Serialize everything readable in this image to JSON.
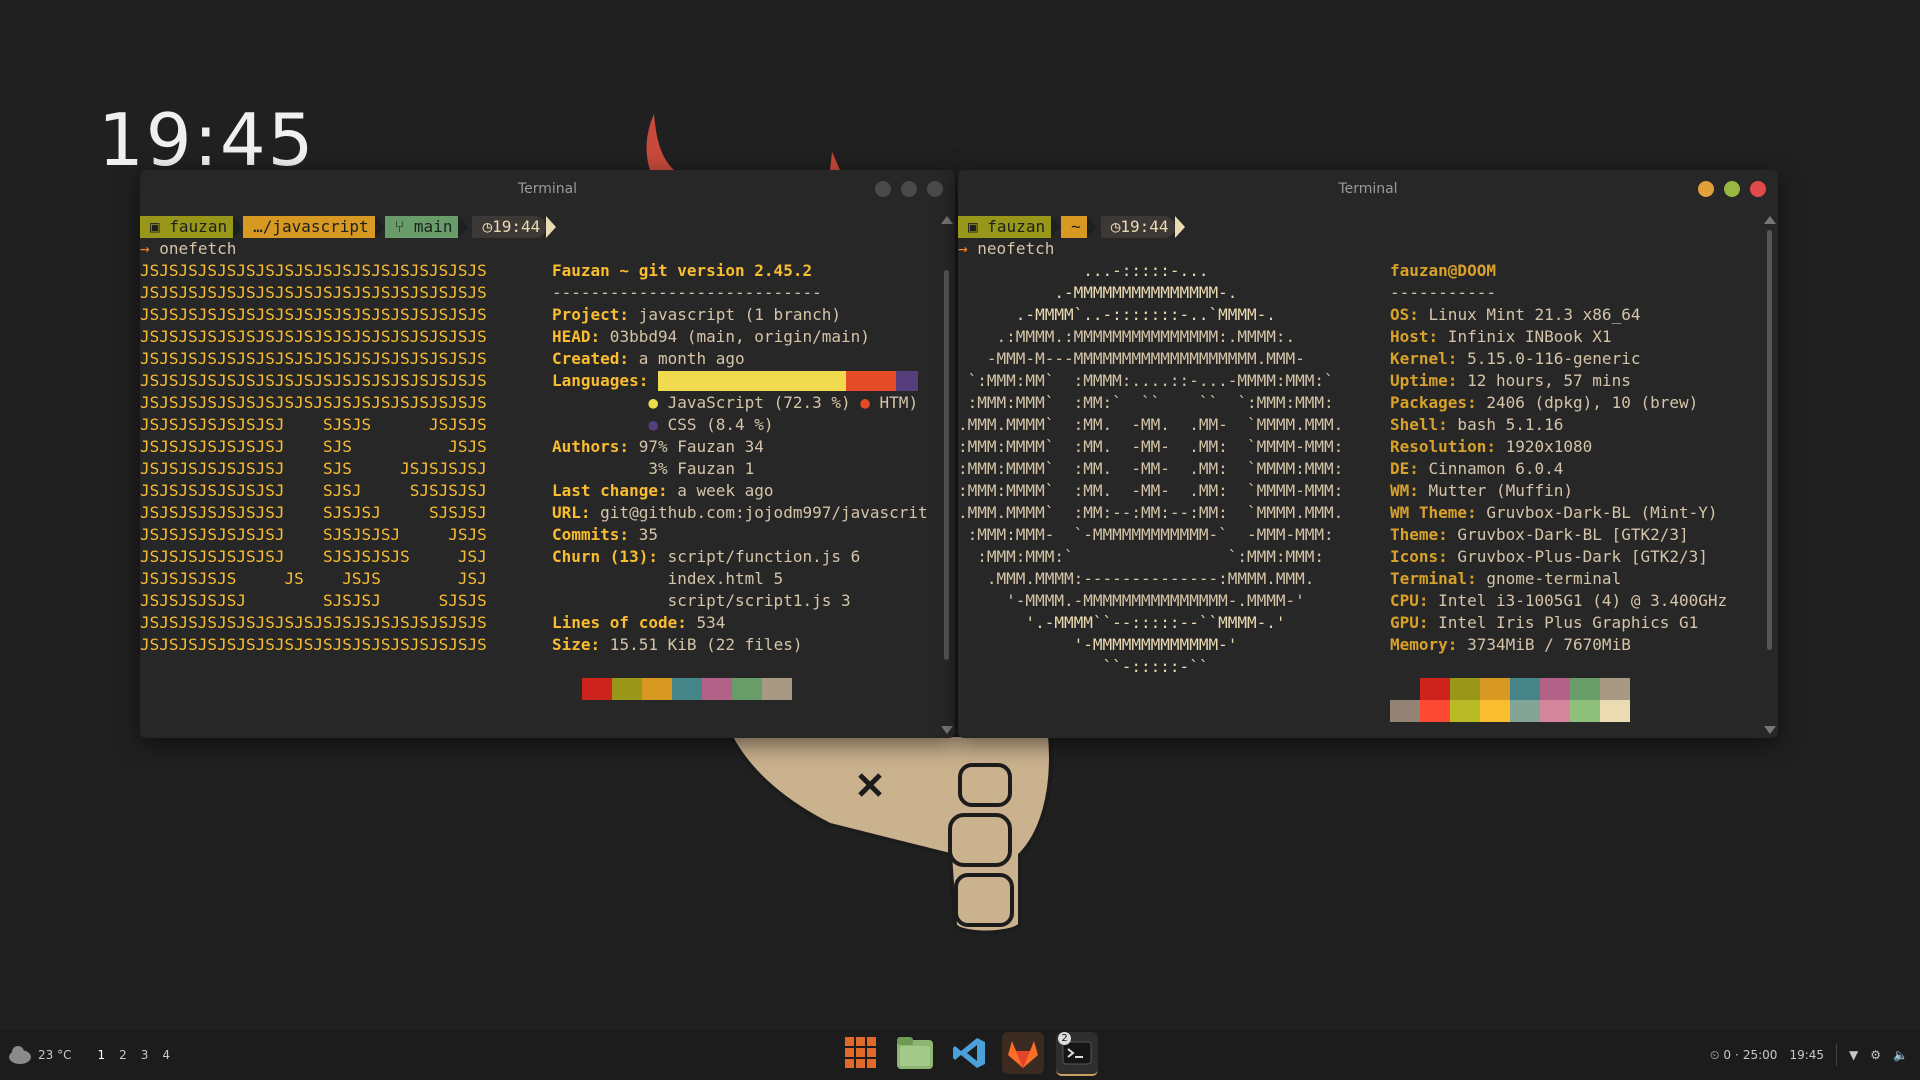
{
  "clock": "19:45",
  "left_terminal": {
    "title": "Terminal",
    "prompt": {
      "user": "fauzan",
      "dir": "…/javascript",
      "branch": "main",
      "time": "19:44"
    },
    "command": "onefetch",
    "logo_lines": [
      "JSJSJSJSJSJSJSJSJSJSJSJSJSJSJSJSJSJS",
      "JSJSJSJSJSJSJSJSJSJSJSJSJSJSJSJSJSJS",
      "JSJSJSJSJSJSJSJSJSJSJSJSJSJSJSJSJSJS",
      "JSJSJSJSJSJSJSJSJSJSJSJSJSJSJSJSJSJS",
      "JSJSJSJSJSJSJSJSJSJSJSJSJSJSJSJSJSJS",
      "JSJSJSJSJSJSJSJSJSJSJSJSJSJSJSJSJSJS",
      "JSJSJSJSJSJSJSJSJSJSJSJSJSJSJSJSJSJS",
      "JSJSJSJSJSJSJSJ    SJSJS      JSJSJS",
      "JSJSJSJSJSJSJSJ    SJS          JSJS",
      "JSJSJSJSJSJSJSJ    SJS     JSJSJSJSJ",
      "JSJSJSJSJSJSJSJ    SJSJ     SJSJSJSJ",
      "JSJSJSJSJSJSJSJ    SJSJSJ     SJSJSJ",
      "JSJSJSJSJSJSJSJ    SJSJSJSJ     JSJS",
      "JSJSJSJSJSJSJSJ    SJSJSJSJS     JSJ",
      "JSJSJSJSJS     JS    JSJS        JSJ",
      "JSJSJSJSJSJ        SJSJSJ      SJSJS",
      "JSJSJSJSJSJSJSJSJSJSJSJSJSJSJSJSJSJS",
      "JSJSJSJSJSJSJSJSJSJSJSJSJSJSJSJSJSJS"
    ],
    "info": {
      "heading": "Fauzan ~ git version 2.45.2",
      "separator": "----------------------------",
      "project_label": "Project:",
      "project": " javascript (1 branch)",
      "head_label": "HEAD:",
      "head": " 03bbd94 (main, origin/main)",
      "created_label": "Created:",
      "created": " a month ago",
      "languages_label": "Languages:",
      "lang1": " JavaScript (72.3 %)",
      "lang2": " HTM)",
      "lang3": " CSS (8.4 %)",
      "authors_label": "Authors:",
      "authors1": " 97% Fauzan 34",
      "authors2": "3% Fauzan 1",
      "lastchange_label": "Last change:",
      "lastchange": " a week ago",
      "url_label": "URL:",
      "url": " git@github.com:jojodm997/javascrit",
      "commits_label": "Commits:",
      "commits": " 35",
      "churn_label": "Churn (13):",
      "churn1": " script/function.js 6",
      "churn2": "index.html 5",
      "churn3": "script/script1.js 3",
      "loc_label": "Lines of code:",
      "loc": " 534",
      "size_label": "Size:",
      "size": " 15.51 KiB (22 files)"
    },
    "language_shares": [
      {
        "name": "JavaScript",
        "percent": 72.3,
        "color": "#f0db4f"
      },
      {
        "name": "HTML",
        "percent": 19.3,
        "color": "#e34c26"
      },
      {
        "name": "CSS",
        "percent": 8.4,
        "color": "#563d7c"
      }
    ],
    "palette": [
      "#282828",
      "#cc241d",
      "#98971a",
      "#d79921",
      "#458588",
      "#b16286",
      "#689d6a",
      "#a89984"
    ]
  },
  "right_terminal": {
    "title": "Terminal",
    "prompt": {
      "user": "fauzan",
      "dir": "~",
      "time": "19:44"
    },
    "command": "neofetch",
    "logo_lines": [
      "             ...-:::::-...",
      "          .-MMMMMMMMMMMMMMM-.",
      "      .-MMMM`..-:::::::-..`MMMM-.",
      "    .:MMMM.:MMMMMMMMMMMMMMM:.MMMM:.",
      "   -MMM-M---MMMMMMMMMMMMMMMMMMM.MMM-",
      " `:MMM:MM`  :MMMM:....::-...-MMMM:MMM:`",
      " :MMM:MMM`  :MM:`  ``    ``  `:MMM:MMM:",
      ".MMM.MMMM`  :MM.  -MM.  .MM-  `MMMM.MMM.",
      ":MMM:MMMM`  :MM.  -MM-  .MM:  `MMMM-MMM:",
      ":MMM:MMMM`  :MM.  -MM-  .MM:  `MMMM:MMM:",
      ":MMM:MMMM`  :MM.  -MM-  .MM:  `MMMM-MMM:",
      ".MMM.MMMM`  :MM:--:MM:--:MM:  `MMMM.MMM.",
      " :MMM:MMM-  `-MMMMMMMMMMMM-`  -MMM-MMM:",
      "  :MMM:MMM:`                `:MMM:MMM:",
      "   .MMM.MMMM:--------------:MMMM.MMM.",
      "     '-MMMM.-MMMMMMMMMMMMMMM-.MMMM-'",
      "       '.-MMMM``--:::::--``MMMM-.'",
      "            '-MMMMMMMMMMMMM-'",
      "               ``-:::::-``"
    ],
    "user_host": "fauzan@DOOM",
    "separator": "-----------",
    "fields": [
      {
        "label": "OS:",
        "value": " Linux Mint 21.3 x86_64"
      },
      {
        "label": "Host:",
        "value": " Infinix INBook X1"
      },
      {
        "label": "Kernel:",
        "value": " 5.15.0-116-generic"
      },
      {
        "label": "Uptime:",
        "value": " 12 hours, 57 mins"
      },
      {
        "label": "Packages:",
        "value": " 2406 (dpkg), 10 (brew)"
      },
      {
        "label": "Shell:",
        "value": " bash 5.1.16"
      },
      {
        "label": "Resolution:",
        "value": " 1920x1080"
      },
      {
        "label": "DE:",
        "value": " Cinnamon 6.0.4"
      },
      {
        "label": "WM:",
        "value": " Mutter (Muffin)"
      },
      {
        "label": "WM Theme:",
        "value": " Gruvbox-Dark-BL (Mint-Y)"
      },
      {
        "label": "Theme:",
        "value": " Gruvbox-Dark-BL [GTK2/3]"
      },
      {
        "label": "Icons:",
        "value": " Gruvbox-Plus-Dark [GTK2/3]"
      },
      {
        "label": "Terminal:",
        "value": " gnome-terminal"
      },
      {
        "label": "CPU:",
        "value": " Intel i3-1005G1 (4) @ 3.400GHz"
      },
      {
        "label": "GPU:",
        "value": " Intel Iris Plus Graphics G1"
      },
      {
        "label": "Memory:",
        "value": " 3734MiB / 7670MiB"
      }
    ],
    "palette_top": [
      "#282828",
      "#cc241d",
      "#98971a",
      "#d79921",
      "#458588",
      "#b16286",
      "#689d6a",
      "#a89984"
    ],
    "palette_bottom": [
      "#928374",
      "#fb4934",
      "#b8bb26",
      "#fabd2f",
      "#83a598",
      "#d3869b",
      "#8ec07c",
      "#ebdbb2"
    ]
  },
  "taskbar": {
    "weather": "23 °C",
    "workspaces": [
      "1",
      "2",
      "3",
      "4"
    ],
    "timer_count": "0",
    "timer_sep": "·",
    "timer": "25:00",
    "time": "19:45",
    "terminal_badge": "2",
    "dock_icons": [
      "app-grid-icon",
      "files-icon",
      "vscode-icon",
      "gitlab-icon",
      "terminal-icon"
    ]
  }
}
